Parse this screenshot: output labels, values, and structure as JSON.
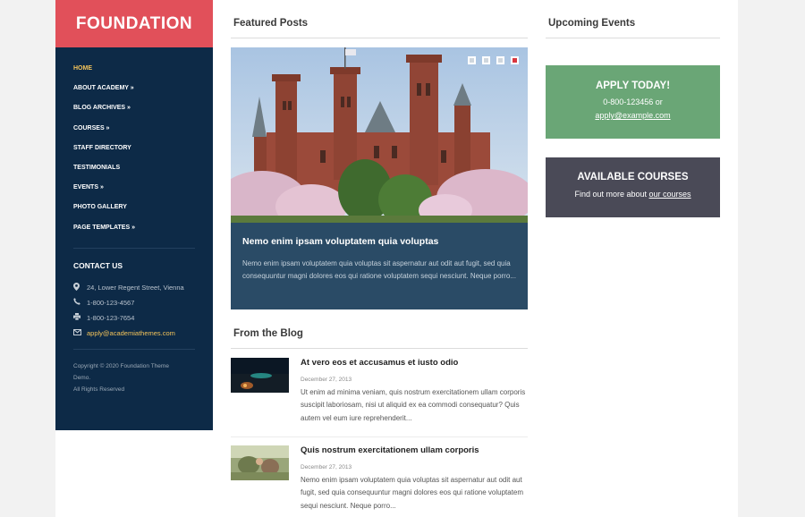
{
  "site": {
    "logo": "FOUNDATION"
  },
  "nav": [
    {
      "label": "HOME",
      "active": true
    },
    {
      "label": "ABOUT ACADEMY »",
      "active": false
    },
    {
      "label": "BLOG ARCHIVES »",
      "active": false
    },
    {
      "label": "COURSES »",
      "active": false
    },
    {
      "label": "STAFF DIRECTORY",
      "active": false
    },
    {
      "label": "TESTIMONIALS",
      "active": false
    },
    {
      "label": "EVENTS »",
      "active": false
    },
    {
      "label": "PHOTO GALLERY",
      "active": false
    },
    {
      "label": "PAGE TEMPLATES »",
      "active": false
    }
  ],
  "contact": {
    "title": "CONTACT US",
    "address": "24, Lower Regent Street, Vienna",
    "phone": "1-800-123-4567",
    "fax": "1-800-123-7654",
    "email": "apply@academiathemes.com",
    "icons": {
      "address": "map-pin-icon",
      "phone": "phone-icon",
      "fax": "printer-icon",
      "email": "envelope-icon"
    }
  },
  "copyright": {
    "line1": "Copyright © 2020 Foundation Theme",
    "line2": "Demo.",
    "line3": "All Rights Reserved"
  },
  "featured": {
    "section_title": "Featured Posts",
    "title": "Nemo enim ipsam voluptatem quia voluptas",
    "excerpt": "Nemo enim ipsam voluptatem quia voluptas sit aspernatur aut odit aut fugit, sed quia consequuntur magni dolores eos qui ratione voluptatem sequi nesciunt. Neque porro...",
    "slides": 4,
    "active_slide": 4
  },
  "blog": {
    "section_title": "From the Blog",
    "posts": [
      {
        "title": "At vero eos et accusamus et iusto odio",
        "date": "December 27, 2013",
        "excerpt": "Ut enim ad minima veniam, quis nostrum exercitationem ullam corporis suscipit laboriosam, nisi ut aliquid ex ea commodi consequatur? Quis autem vel eum iure reprehenderit..."
      },
      {
        "title": "Quis nostrum exercitationem ullam corporis",
        "date": "December 27, 2013",
        "excerpt": "Nemo enim ipsam voluptatem quia voluptas sit aspernatur aut odit aut fugit, sed quia consequuntur magni dolores eos qui ratione voluptatem sequi nesciunt. Neque porro..."
      }
    ]
  },
  "events": {
    "section_title": "Upcoming Events",
    "apply": {
      "title": "APPLY TODAY!",
      "phone_line": "0-800-123456 or",
      "email_link": "apply@example.com",
      "color": "#6aa676"
    },
    "courses": {
      "title": "AVAILABLE COURSES",
      "text": "Find out more about ",
      "link": "our courses",
      "color": "#4a4a57"
    }
  },
  "colors": {
    "brand": "#e1505a",
    "sidebar": "#0d2a47",
    "caption": "#2a4b66",
    "highlight": "#f3c35a"
  }
}
